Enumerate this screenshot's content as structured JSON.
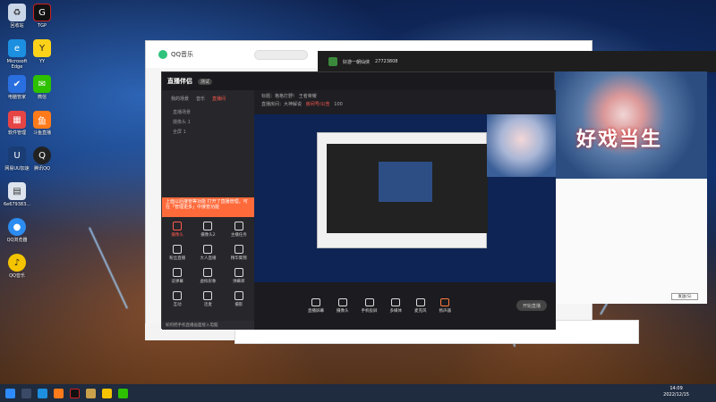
{
  "desktop_icons": [
    {
      "label": "回收站",
      "icon": "recycle-bin-icon"
    },
    {
      "label": "Microsoft Edge",
      "icon": "edge-icon"
    },
    {
      "label": "电脑管家",
      "icon": "pc-manager-icon"
    },
    {
      "label": "软件管理",
      "icon": "software-manager-icon"
    },
    {
      "label": "网易UU加速",
      "icon": "uu-accelerator-icon"
    },
    {
      "label": "6e679383...",
      "icon": "file-icon"
    },
    {
      "label": "QQ浏览器",
      "icon": "qq-browser-icon"
    },
    {
      "label": "QQ音乐",
      "icon": "qq-music-icon"
    },
    {
      "label": "TGP",
      "icon": "tgp-icon"
    },
    {
      "label": "YY",
      "icon": "yy-icon"
    },
    {
      "label": "微信",
      "icon": "wechat-icon"
    },
    {
      "label": "斗鱼直播",
      "icon": "douyu-icon"
    },
    {
      "label": "腾讯QQ",
      "icon": "qq-icon"
    }
  ],
  "qqmusic": {
    "title": "QQ音乐"
  },
  "live": {
    "brand": "直播伴侣",
    "beta": "测试",
    "tabs": [
      "我的场景",
      "音乐",
      "直播间"
    ],
    "layers": [
      "直播场景",
      "摄像头 1",
      "全屏 1"
    ],
    "info_line1": "标题：格格打野!",
    "info_category": "王者荣耀",
    "info_line2": "直播房间：大神解说",
    "info_id": "房间号/公告",
    "info_count": "100",
    "tip": "上面以后接管等功能 打开了直播管理，可在「管理更多」中接管功能",
    "tools": [
      "摄像头",
      "摄像头2",
      "主播任务",
      "粉丝直播",
      "大人直播",
      "精华集锦",
      "读弹幕",
      "虚拟形象",
      "弹幕库",
      "互动",
      "连麦",
      "摄影"
    ],
    "more": "如何把手机直播画面接入电脑",
    "bottom": [
      "直播屏幕",
      "摄像头",
      "手机投屏",
      "多媒体",
      "麦克风",
      "扬声器"
    ],
    "start": "开始直播"
  },
  "game": {
    "title": "好游一朝仙侠",
    "id": "27723808"
  },
  "anime": {
    "text": "好戏当生"
  },
  "chat": {
    "send": "发送(S)"
  },
  "taskbar": {
    "time": "14:09",
    "date": "2022/12/15"
  }
}
